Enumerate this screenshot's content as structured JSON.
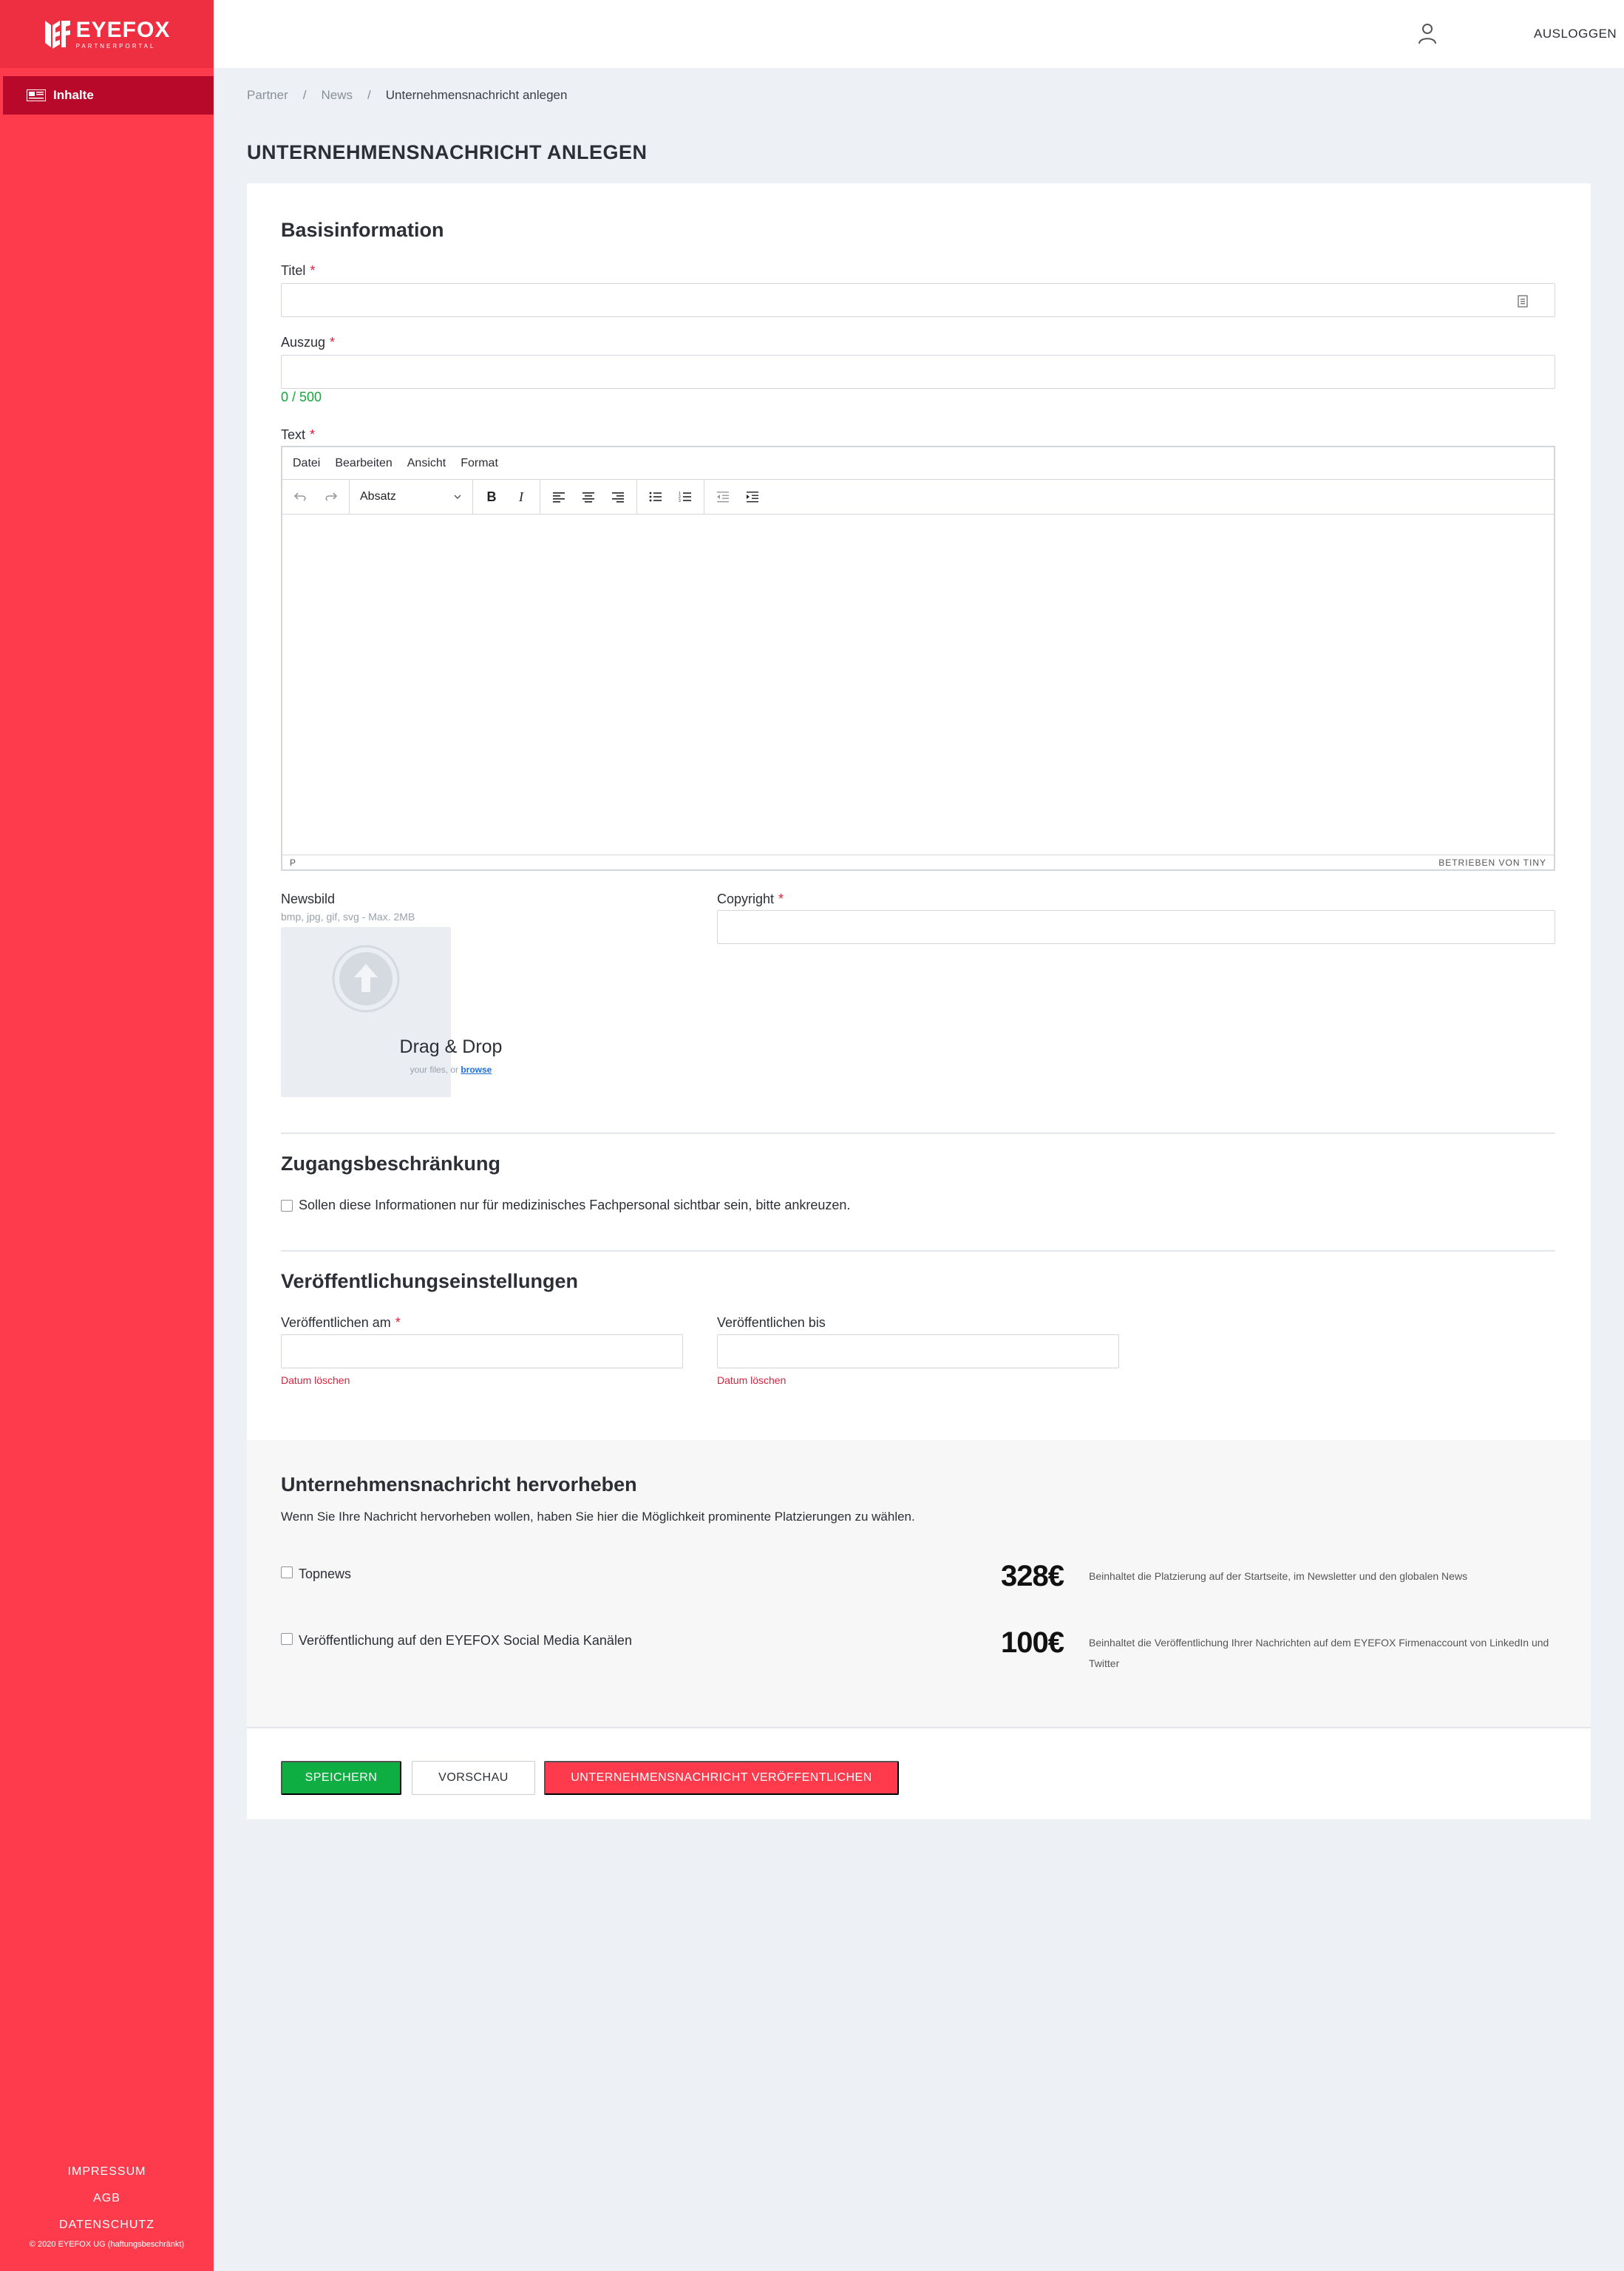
{
  "brand": {
    "name": "EYEFOX",
    "tagline": "PARTNERPORTAL"
  },
  "sidebar": {
    "items": [
      {
        "label": "Inhalte"
      }
    ],
    "footer": {
      "links": [
        "IMPRESSUM",
        "AGB",
        "DATENSCHUTZ"
      ],
      "copyright": "© 2020 EYEFOX UG (haftungsbeschränkt)"
    }
  },
  "topbar": {
    "user_icon": "user-icon",
    "logout_label": "AUSLOGGEN"
  },
  "breadcrumb": [
    "Partner",
    "News",
    "Unternehmensnachricht anlegen"
  ],
  "page_title": "UNTERNEHMENSNACHRICHT ANLEGEN",
  "basis": {
    "title": "Basisinformation",
    "titel_label": "Titel",
    "auszug_label": "Auszug",
    "counter": "0 / 500",
    "text_label": "Text",
    "required_mark": "*"
  },
  "editor": {
    "menus": [
      "Datei",
      "Bearbeiten",
      "Ansicht",
      "Format"
    ],
    "block_format": "Absatz",
    "status_path": "P",
    "powered_by": "BETRIEBEN VON TINY"
  },
  "newsbild": {
    "label": "Newsbild",
    "hint": "bmp, jpg, gif, svg - Max. 2MB",
    "drop_title": "Drag & Drop",
    "drop_sub": "your files, or",
    "browse": "browse"
  },
  "copyright_field": {
    "label": "Copyright"
  },
  "access": {
    "title": "Zugangsbeschränkung",
    "checkbox_label": "Sollen diese Informationen nur für medizinisches Fachpersonal sichtbar sein, bitte ankreuzen."
  },
  "publish_settings": {
    "title": "Veröffentlichungseinstellungen",
    "from_label": "Veröffentlichen am",
    "to_label": "Veröffentlichen bis",
    "clear_date": "Datum löschen"
  },
  "highlight": {
    "title": "Unternehmensnachricht hervorheben",
    "description": "Wenn Sie Ihre Nachricht hervorheben wollen, haben Sie hier die Möglichkeit prominente Platzierungen zu wählen.",
    "options": [
      {
        "label": "Topnews",
        "price": "328€",
        "description": "Beinhaltet die Platzierung auf der Startseite, im Newsletter und den globalen News"
      },
      {
        "label": "Veröffentlichung auf den EYEFOX Social Media Kanälen",
        "price": "100€",
        "description": "Beinhaltet die Veröffentlichung Ihrer Nachrichten auf dem EYEFOX Firmenaccount von LinkedIn und Twitter"
      }
    ]
  },
  "actions": {
    "save": "SPEICHERN",
    "preview": "VORSCHAU",
    "publish": "UNTERNEHMENSNACHRICHT VERÖFFENTLICHEN"
  },
  "colors": {
    "brand_red": "#fd3b4c",
    "sidebar_active": "#b8092a",
    "success_green": "#0fae43"
  }
}
